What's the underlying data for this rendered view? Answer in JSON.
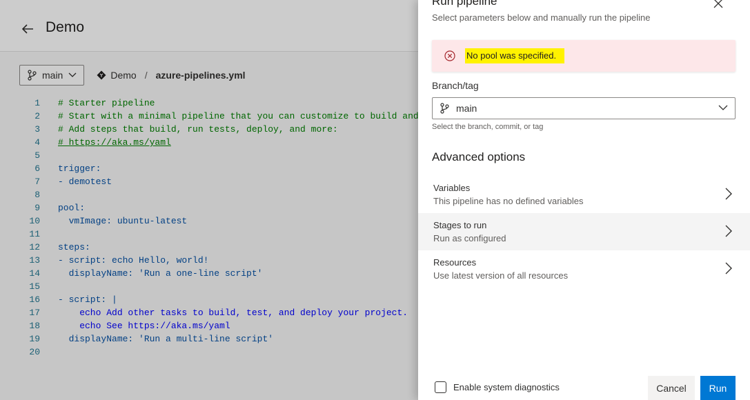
{
  "page": {
    "title": "Demo",
    "branch": "main",
    "repo": "Demo",
    "separator": "/",
    "file": "azure-pipelines.yml"
  },
  "editor": {
    "line_numbers": [
      "1",
      "2",
      "3",
      "4",
      "5",
      "6",
      "7",
      "8",
      "9",
      "10",
      "11",
      "12",
      "13",
      "14",
      "15",
      "16",
      "17",
      "18",
      "19",
      "20"
    ],
    "lines": [
      "# Starter pipeline",
      "# Start with a minimal pipeline that you can customize to build and",
      "# Add steps that build, run tests, deploy, and more:",
      "# https://aka.ms/yaml",
      "",
      "trigger:",
      "- demotest",
      "",
      "pool:",
      "  vmImage: ubuntu-latest",
      "",
      "steps:",
      "- script: echo Hello, world!",
      "  displayName: 'Run a one-line script'",
      "",
      "- script: |",
      "    echo Add other tasks to build, test, and deploy your project.",
      "    echo See https://aka.ms/yaml",
      "  displayName: 'Run a multi-line script'",
      ""
    ]
  },
  "panel": {
    "title": "Run pipeline",
    "subtitle": "Select parameters below and manually run the pipeline",
    "error": "No pool was specified.",
    "branch_label": "Branch/tag",
    "branch_value": "main",
    "branch_hint": "Select the branch, commit, or tag",
    "advanced_title": "Advanced options",
    "options": [
      {
        "title": "Variables",
        "subtitle": "This pipeline has no defined variables"
      },
      {
        "title": "Stages to run",
        "subtitle": "Run as configured"
      },
      {
        "title": "Resources",
        "subtitle": "Use latest version of all resources"
      }
    ],
    "diagnostics_label": "Enable system diagnostics",
    "cancel_label": "Cancel",
    "run_label": "Run"
  },
  "colors": {
    "accent": "#0078d4",
    "error_bg": "#fde7e9",
    "error_icon": "#a4262c",
    "highlight": "#fff200"
  }
}
